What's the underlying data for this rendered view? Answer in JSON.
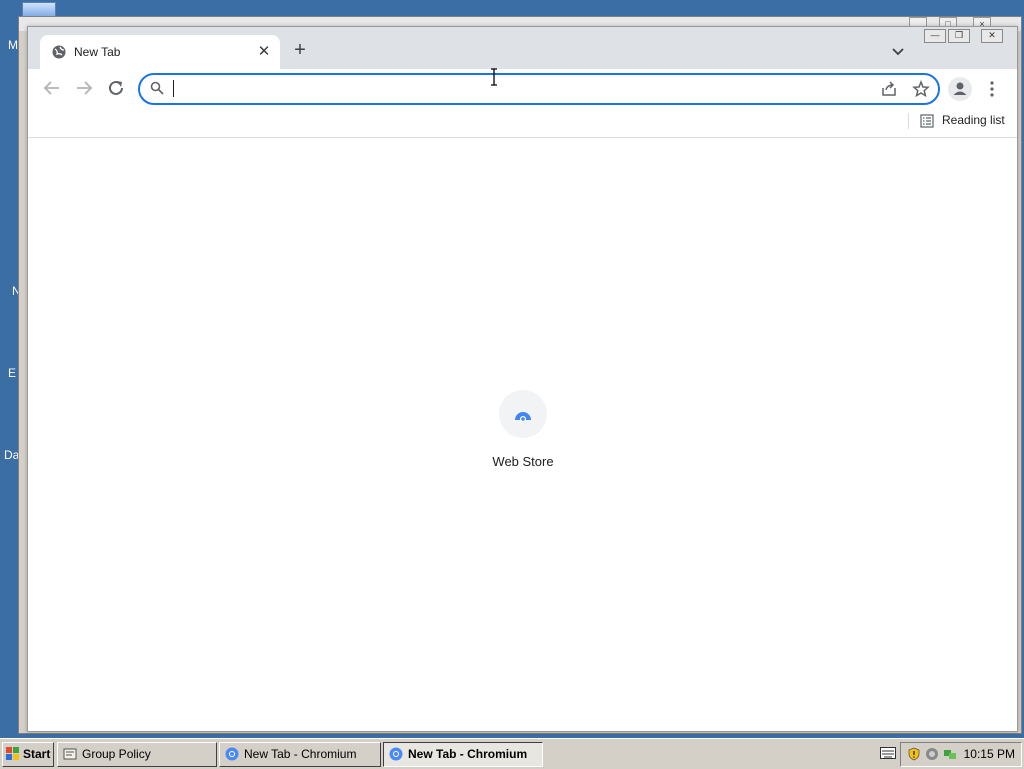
{
  "desktop": {
    "letters": [
      "M",
      "N",
      "E",
      "Da"
    ]
  },
  "browser": {
    "tab": {
      "title": "New Tab"
    },
    "toolbar": {
      "omnibox_value": ""
    },
    "bookmarks_bar": {
      "reading_list_label": "Reading list"
    },
    "new_tab_page": {
      "shortcuts": [
        {
          "label": "Web Store"
        }
      ]
    },
    "accent_color": "#1a73e8"
  },
  "taskbar": {
    "start_label": "Start",
    "tasks": [
      {
        "label": "Group Policy",
        "icon": "group-policy-icon",
        "active": false
      },
      {
        "label": "New Tab - Chromium",
        "icon": "chromium-icon",
        "active": false
      },
      {
        "label": "New Tab - Chromium",
        "icon": "chromium-icon",
        "active": true
      }
    ],
    "clock": "10:15 PM"
  }
}
